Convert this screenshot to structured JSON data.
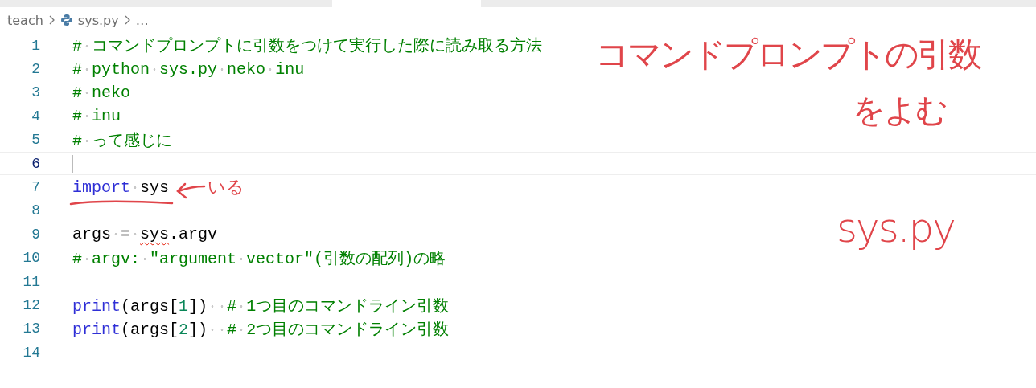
{
  "breadcrumb": [
    {
      "label": "teach",
      "kind": "folder"
    },
    {
      "label": "sys.py",
      "kind": "file"
    },
    {
      "label": "…",
      "kind": "more"
    }
  ],
  "editor": {
    "lines": [
      {
        "number": "1",
        "current": false,
        "tokens": [
          {
            "kind": "comment",
            "text": "# コマンドプロンプトに引数をつけて実行した際に読み取る方法"
          }
        ]
      },
      {
        "number": "2",
        "current": false,
        "tokens": [
          {
            "kind": "comment",
            "text": "# python sys.py neko inu"
          }
        ]
      },
      {
        "number": "3",
        "current": false,
        "tokens": [
          {
            "kind": "comment",
            "text": "# neko"
          }
        ]
      },
      {
        "number": "4",
        "current": false,
        "tokens": [
          {
            "kind": "comment",
            "text": "# inu"
          }
        ]
      },
      {
        "number": "5",
        "current": false,
        "tokens": [
          {
            "kind": "comment",
            "text": "# って感じに"
          }
        ]
      },
      {
        "number": "6",
        "current": true
      },
      {
        "number": "7",
        "current": false,
        "tokens": [
          {
            "kind": "keyword",
            "text": "import"
          },
          {
            "kind": "plain",
            "text": " sys"
          }
        ]
      },
      {
        "number": "8",
        "current": false
      },
      {
        "number": "9",
        "current": false,
        "tokens": [
          {
            "kind": "plain",
            "text": "args = "
          },
          {
            "kind": "plain",
            "text": "sys",
            "squiggle": true
          },
          {
            "kind": "plain",
            "text": ".argv"
          }
        ]
      },
      {
        "number": "10",
        "current": false,
        "tokens": [
          {
            "kind": "comment",
            "text": "# argv: \"argument vector\"(引数の配列)の略"
          }
        ]
      },
      {
        "number": "11",
        "current": false
      },
      {
        "number": "12",
        "current": false,
        "tokens": [
          {
            "kind": "keyword",
            "text": "print"
          },
          {
            "kind": "plain",
            "text": "(args["
          },
          {
            "kind": "number",
            "text": "1"
          },
          {
            "kind": "plain",
            "text": "])  "
          },
          {
            "kind": "comment",
            "text": "# 1つ目のコマンドライン引数"
          }
        ]
      },
      {
        "number": "13",
        "current": false,
        "tokens": [
          {
            "kind": "keyword",
            "text": "print"
          },
          {
            "kind": "plain",
            "text": "(args["
          },
          {
            "kind": "number",
            "text": "2"
          },
          {
            "kind": "plain",
            "text": "])  "
          },
          {
            "kind": "comment",
            "text": "# 2つ目のコマンドライン引数"
          }
        ]
      },
      {
        "number": "14",
        "current": false
      }
    ]
  },
  "annotations": [
    {
      "text": "コマンドプロンプトの引数"
    },
    {
      "text": "をよむ"
    },
    {
      "text": "いる"
    },
    {
      "text": "sys.py"
    }
  ]
}
